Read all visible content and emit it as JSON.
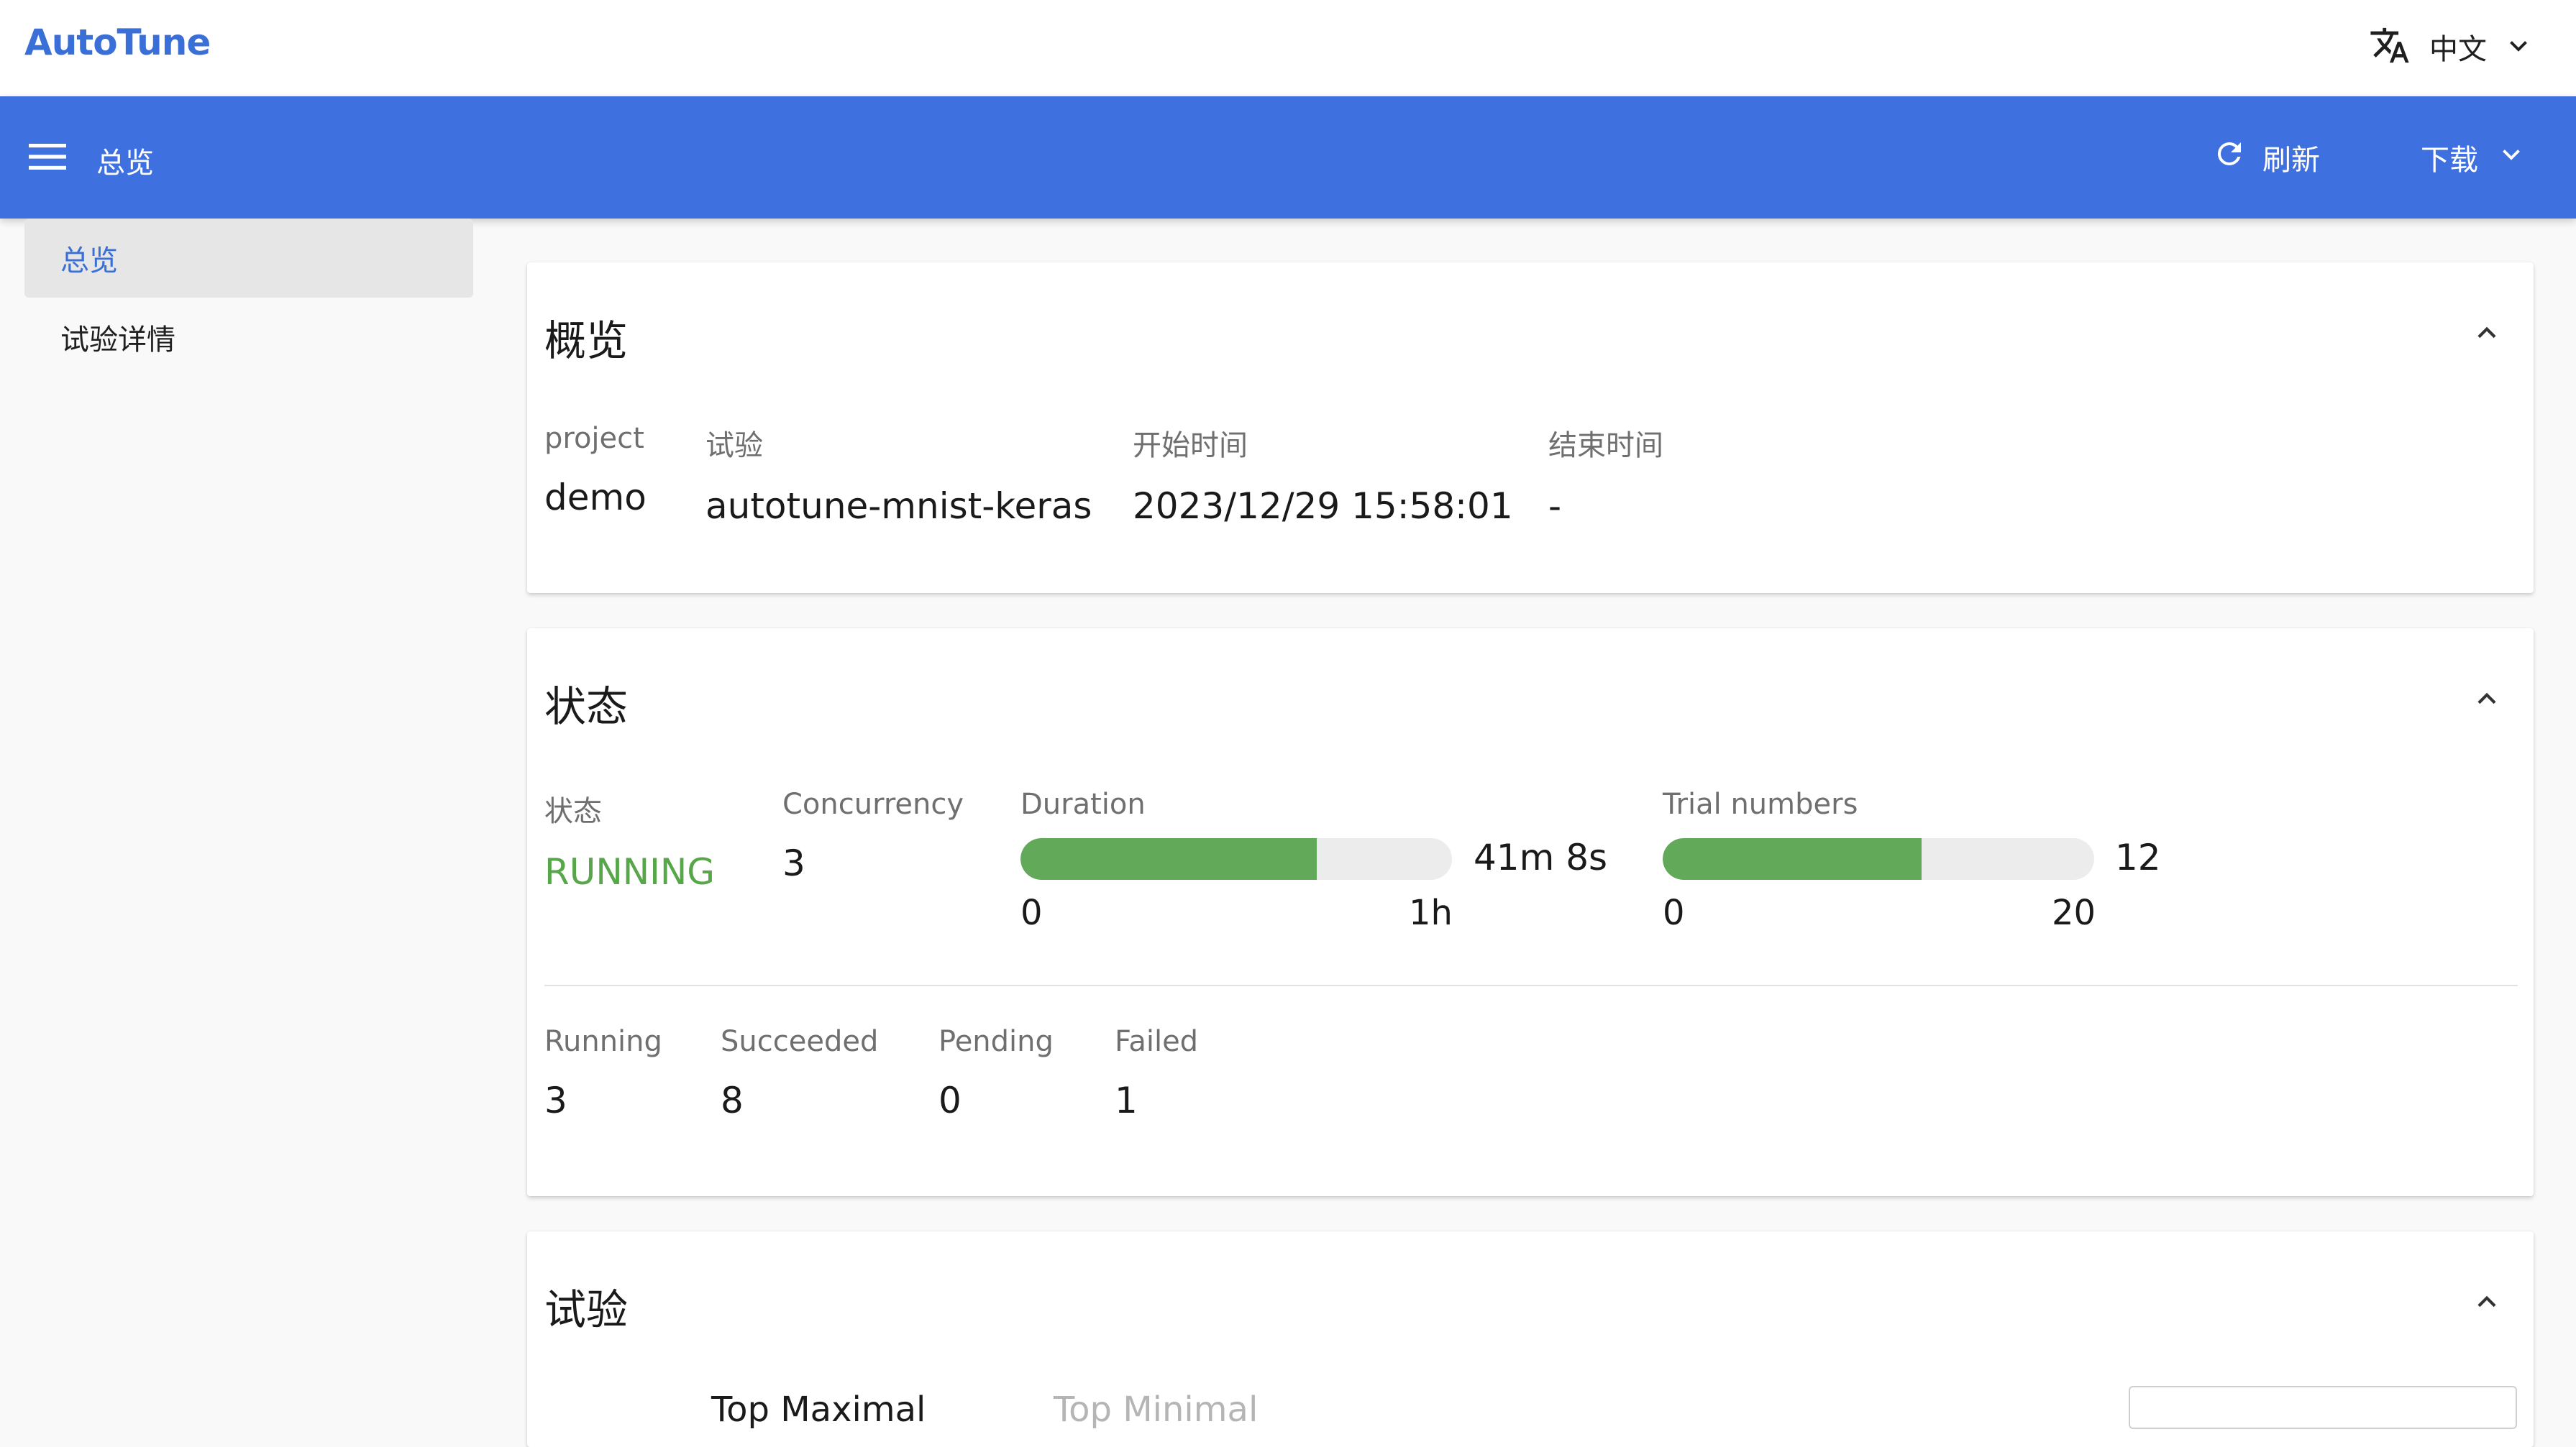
{
  "app": {
    "logo": "AutoTune",
    "language": "中文"
  },
  "appbar": {
    "title": "总览",
    "refresh_label": "刷新",
    "download_label": "下载"
  },
  "sidebar": {
    "items": [
      {
        "label": "总览",
        "active": true
      },
      {
        "label": "试验详情",
        "active": false
      }
    ]
  },
  "overview": {
    "title": "概览",
    "fields": [
      {
        "label": "project",
        "value": "demo"
      },
      {
        "label": "试验",
        "value": "autotune-mnist-keras"
      },
      {
        "label": "开始时间",
        "value": "2023/12/29 15:58:01"
      },
      {
        "label": "结束时间",
        "value": "-"
      }
    ]
  },
  "status": {
    "title": "状态",
    "state_label": "状态",
    "state_value": "RUNNING",
    "concurrency_label": "Concurrency",
    "concurrency_value": "3",
    "duration": {
      "label": "Duration",
      "value": "41m 8s",
      "min": "0",
      "max": "1h",
      "fraction": 0.686
    },
    "trials": {
      "label": "Trial numbers",
      "value": "12",
      "min": "0",
      "max": "20",
      "fraction": 0.6
    },
    "counts": [
      {
        "label": "Running",
        "value": "3"
      },
      {
        "label": "Succeeded",
        "value": "8"
      },
      {
        "label": "Pending",
        "value": "0"
      },
      {
        "label": "Failed",
        "value": "1"
      }
    ]
  },
  "experiments": {
    "title": "试验",
    "tab_maximal": "Top Maximal",
    "tab_minimal": "Top Minimal"
  },
  "colors": {
    "primary": "#3e70e0",
    "running": "#57a64a",
    "progress_fill": "#63a95a"
  },
  "icons": {
    "translate": "translate-icon",
    "menu": "menu-icon",
    "refresh": "refresh-icon",
    "chevron_down": "chevron-down-icon",
    "chevron_up": "chevron-up-icon"
  }
}
